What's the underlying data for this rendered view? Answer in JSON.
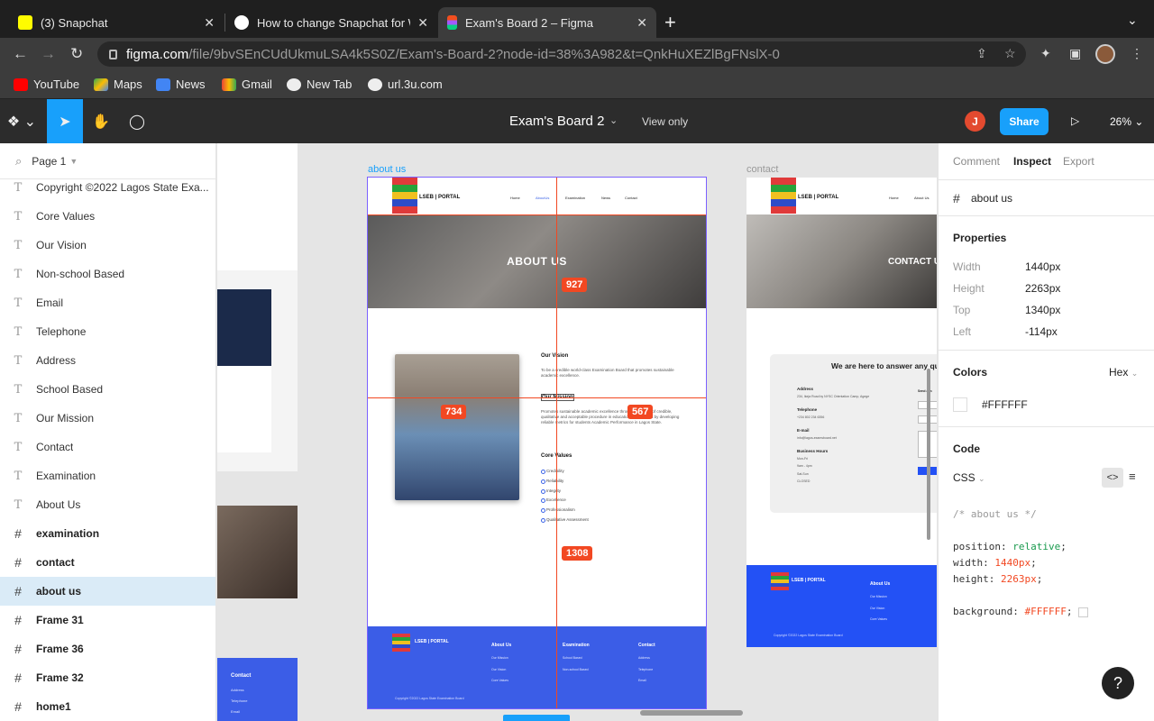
{
  "browser": {
    "tabs": [
      {
        "label": "(3) Snapchat",
        "color": "#fffc00"
      },
      {
        "label": "How to change Snapchat for W",
        "color": "#ffffff"
      },
      {
        "label": "Exam's Board 2 – Figma",
        "color": "#f24e1e"
      }
    ],
    "url_domain": "figma.com",
    "url_path": "/file/9bvSEnCUdUkmuLSA4k5S0Z/Exam's-Board-2?node-id=38%3A982&t=QnkHuXEZlBgFNslX-0",
    "bookmarks": [
      "YouTube",
      "Maps",
      "News",
      "Gmail",
      "New Tab",
      "url.3u.com"
    ]
  },
  "figma": {
    "title": "Exam's Board 2",
    "view_only": "View only",
    "user_initial": "J",
    "share": "Share",
    "zoom": "26%",
    "page": "Page 1",
    "layers": [
      {
        "name": "Copyright ©2022 Lagos State Exa...",
        "type": "text"
      },
      {
        "name": "Core Values",
        "type": "text"
      },
      {
        "name": "Our Vision",
        "type": "text"
      },
      {
        "name": "Non-school Based",
        "type": "text"
      },
      {
        "name": "Email",
        "type": "text"
      },
      {
        "name": "Telephone",
        "type": "text"
      },
      {
        "name": "Address",
        "type": "text"
      },
      {
        "name": "School Based",
        "type": "text"
      },
      {
        "name": "Our Mission",
        "type": "text"
      },
      {
        "name": "Contact",
        "type": "text"
      },
      {
        "name": "Examination",
        "type": "text"
      },
      {
        "name": "About Us",
        "type": "text"
      },
      {
        "name": "examination",
        "type": "frame"
      },
      {
        "name": "contact",
        "type": "frame"
      },
      {
        "name": "about us",
        "type": "frame",
        "selected": true
      },
      {
        "name": "Frame 31",
        "type": "frame"
      },
      {
        "name": "Frame 36",
        "type": "frame"
      },
      {
        "name": "Frame 32",
        "type": "frame"
      },
      {
        "name": "home1",
        "type": "frame"
      }
    ]
  },
  "canvas": {
    "about_label": "about us",
    "contact_label": "contact",
    "about_page": {
      "brand": "LSEB | PORTAL",
      "nav": [
        "Home",
        "AboutUs",
        "Examination",
        "News",
        "Contact"
      ],
      "hero": "ABOUT US",
      "vision_title": "Our Vision",
      "vision_text": "To be a credible world-class Examination Board that promotes sustainable academic excellence.",
      "mission_title": "Our Mission",
      "mission_text": "Promotes sustainable academic excellence through provision of credible, qualitative and acceptable procedure in education assessment by developing reliable metrics for students Academic Performance in Lagos State.",
      "core_title": "Core Values",
      "core_values": [
        "Credibility",
        "Reliability",
        "Integrity",
        "Excellence",
        "Professionalism",
        "Qualitative Assessment"
      ],
      "footer": {
        "brand": "LSEB | PORTAL",
        "cols": [
          {
            "title": "About Us",
            "items": [
              "Our Mission",
              "Our Vision",
              "Core Values"
            ]
          },
          {
            "title": "Examination",
            "items": [
              "School Based",
              "Non-school Based"
            ]
          },
          {
            "title": "Contact",
            "items": [
              "Address",
              "Telephone",
              "Email"
            ]
          }
        ],
        "copyright": "Copyright ©2022 Lagos State Examination Board"
      }
    },
    "contact_page": {
      "brand": "LSEB | PORTAL",
      "nav": [
        "Home",
        "About Us"
      ],
      "hero": "CONTACT U",
      "card_title": "We are here to answer any ques",
      "address_label": "Address",
      "address": "234, Ikeja Road by NYSC Orientation Camp, Agege",
      "telephone_label": "Telephone",
      "telephone": "+234 802 234 6356",
      "email_label": "E-mail",
      "email": "info@lagos-examsboard.net",
      "hours_label": "Business Hours",
      "hours": [
        "Mon-Fri",
        "9am - 4pm",
        "Sat-Sun",
        "CLOSED"
      ],
      "send": "Send a m",
      "footer_title": "About Us",
      "footer_items": [
        "Our Mission",
        "Our Vision",
        "Core Values"
      ],
      "copyright": "Copyright ©2022 Lagos State Examination Board"
    },
    "left_frame_text": "Contact",
    "left_frame_items": [
      "Address",
      "Telephone",
      "Email"
    ],
    "measurements": [
      "927",
      "734",
      "567",
      "1308"
    ]
  },
  "inspect": {
    "tabs": [
      "Comment",
      "Inspect",
      "Export"
    ],
    "layer": "about us",
    "properties_title": "Properties",
    "props": [
      {
        "k": "Width",
        "v": "1440px"
      },
      {
        "k": "Height",
        "v": "2263px"
      },
      {
        "k": "Top",
        "v": "1340px"
      },
      {
        "k": "Left",
        "v": "-114px"
      }
    ],
    "colors_title": "Colors",
    "color_format": "Hex",
    "color_value": "#FFFFFF",
    "code_title": "Code",
    "code_lang": "CSS",
    "code_comment": "/* about us */",
    "code_lines": [
      {
        "prop": "position",
        "val": "relative"
      },
      {
        "prop": "width",
        "val": "1440px"
      },
      {
        "prop": "height",
        "val": "2263px"
      },
      {
        "prop": "background",
        "val": "#FFFFFF"
      }
    ],
    "help": "?"
  }
}
